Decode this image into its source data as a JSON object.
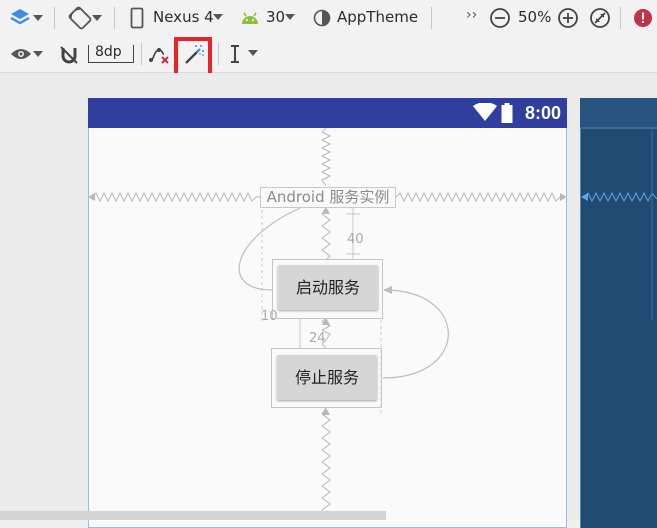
{
  "toolbar_top": {
    "device": "Nexus 4",
    "api_level": "30",
    "theme": "AppTheme",
    "overflow": "››",
    "zoom": "50%"
  },
  "toolbar_second": {
    "default_margin": "8dp"
  },
  "device_screen": {
    "status_time": "8:00",
    "title_text": "Android 服务实例",
    "start_button_label": "启动服务",
    "stop_button_label": "停止服务",
    "margin_top_label": "40",
    "margin_left_label": "10",
    "spacing_label": "24"
  },
  "colors": {
    "status_bar": "#303f9f",
    "blueprint": "#1f4a72",
    "highlight": "#e8242a",
    "error": "#c0334b"
  },
  "icons": [
    "layers-icon",
    "rotate-icon",
    "phone-icon",
    "android-icon",
    "theme-icon",
    "zoom-out-icon",
    "zoom-in-icon",
    "zoom-fit-icon",
    "error-icon",
    "eye-icon",
    "magnet-off-icon",
    "clear-constraints-icon",
    "infer-constraints-icon",
    "guidelines-icon"
  ]
}
